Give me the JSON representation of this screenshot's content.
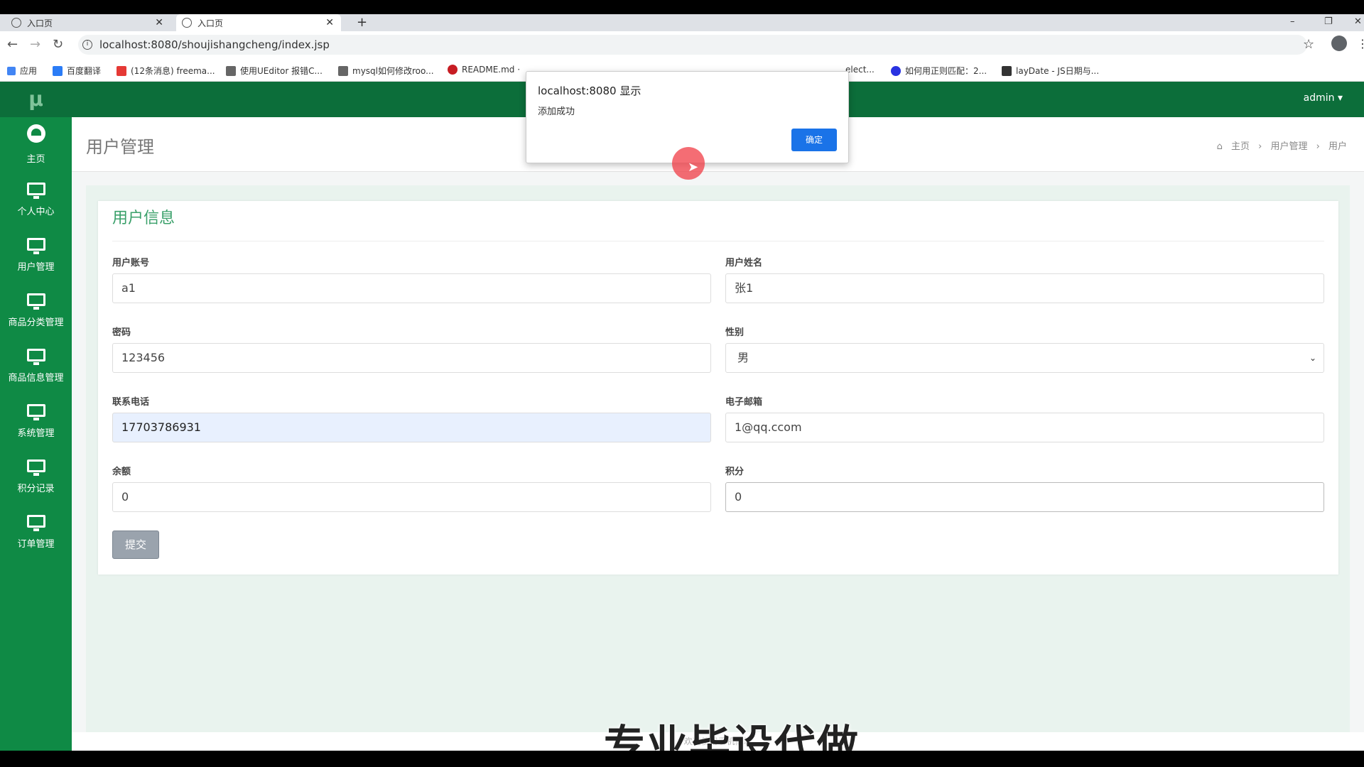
{
  "browser": {
    "tabs": [
      {
        "title": "入口页",
        "active": false
      },
      {
        "title": "入口页",
        "active": true
      }
    ],
    "new_tab": "+",
    "window_controls": [
      "–",
      "❐",
      "✕"
    ],
    "url": "localhost:8080/shoujishangcheng/index.jsp",
    "bookmarks": [
      {
        "label": "应用",
        "color": "#4285f4"
      },
      {
        "label": "百度翻译",
        "color": "#2b7cf6"
      },
      {
        "label": "(12条消息) freema...",
        "color": "#e53935"
      },
      {
        "label": "使用UEditor 报错C...",
        "color": "#666666"
      },
      {
        "label": "mysql如何修改roo...",
        "color": "#666666"
      },
      {
        "label": "README.md · ",
        "color": "#c71d23"
      },
      {
        "label": "elect...",
        "color": "#ffffff"
      },
      {
        "label": "如何用正则匹配：2...",
        "color": "#2932e1"
      },
      {
        "label": "layDate - JS日期与...",
        "color": "#333333"
      }
    ]
  },
  "app": {
    "logo": "μ",
    "user": "admin ▾",
    "sidebar": [
      {
        "label": "主页",
        "icon": "dashboard-icon"
      },
      {
        "label": "个人中心",
        "icon": "monitor-icon"
      },
      {
        "label": "用户管理",
        "icon": "monitor-icon"
      },
      {
        "label": "商品分类管理",
        "icon": "monitor-icon"
      },
      {
        "label": "商品信息管理",
        "icon": "monitor-icon"
      },
      {
        "label": "系统管理",
        "icon": "monitor-icon"
      },
      {
        "label": "积分记录",
        "icon": "monitor-icon"
      },
      {
        "label": "订单管理",
        "icon": "monitor-icon"
      }
    ],
    "page_title": "用户管理",
    "breadcrumb": [
      "主页",
      "用户管理",
      "用户"
    ],
    "breadcrumb_sep": "›"
  },
  "form": {
    "title": "用户信息",
    "fields": {
      "account": {
        "label": "用户账号",
        "value": "a1"
      },
      "name": {
        "label": "用户姓名",
        "value": "张1"
      },
      "password": {
        "label": "密码",
        "value": "123456"
      },
      "gender": {
        "label": "性别",
        "value": "男"
      },
      "phone": {
        "label": "联系电话",
        "value": "17703786931"
      },
      "email": {
        "label": "电子邮箱",
        "value": "1@qq.ccom"
      },
      "balance": {
        "label": "余额",
        "value": "0"
      },
      "points": {
        "label": "积分",
        "value": "0"
      }
    },
    "submit": "提交"
  },
  "dialog": {
    "title": "localhost:8080 显示",
    "message": "添加成功",
    "ok": "确定"
  },
  "footer": "欢迎使用手机商城",
  "watermark": "专业毕设代做",
  "colors": {
    "sidebar": "#0f8a45",
    "topbar": "#0c6e3a",
    "accent_title": "#3aa06a",
    "dialog_button": "#1a73e8"
  }
}
